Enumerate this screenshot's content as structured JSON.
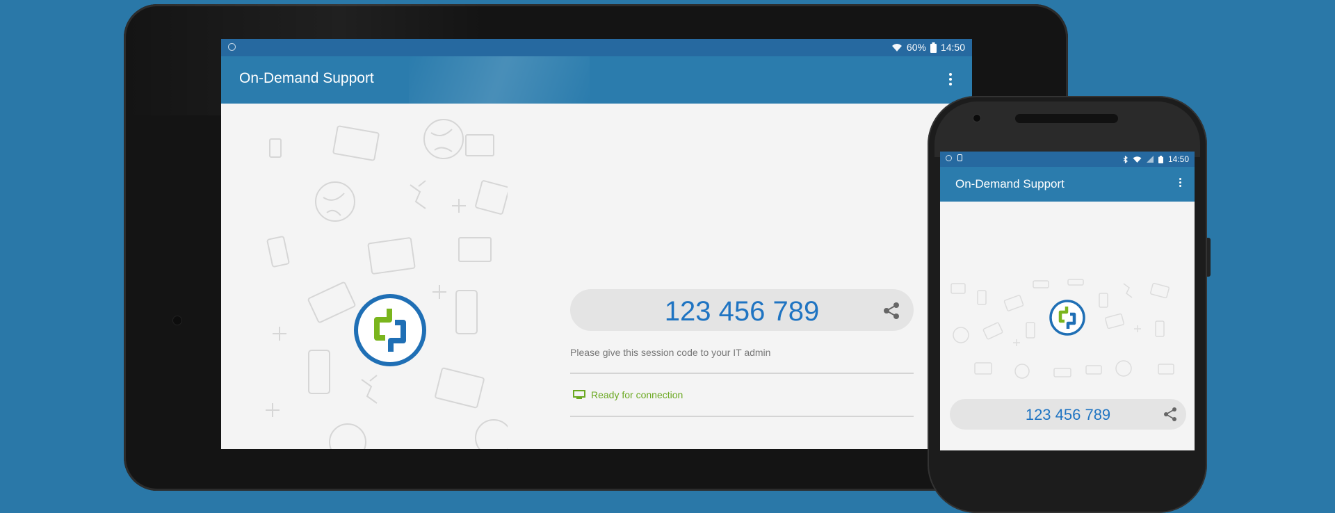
{
  "app": {
    "title": "On-Demand Support"
  },
  "tablet": {
    "status": {
      "battery": "60%",
      "time": "14:50"
    },
    "session_code": "123 456 789",
    "hint": "Please give this session code to your IT admin",
    "connection_status": "Ready for connection"
  },
  "phone": {
    "status": {
      "time": "14:50"
    },
    "session_code": "123 456 789"
  },
  "colors": {
    "background": "#2a78a8",
    "appbar": "#2b7cad",
    "statusbar": "#2669a0",
    "code_text": "#1f74c2",
    "ready_green": "#6aa820",
    "logo_green": "#7ab51d",
    "logo_blue": "#1f6fb5"
  },
  "icons": [
    "wifi-icon",
    "battery-icon",
    "more-vert-icon",
    "share-icon",
    "monitor-icon",
    "logo-icon",
    "bluetooth-icon"
  ]
}
